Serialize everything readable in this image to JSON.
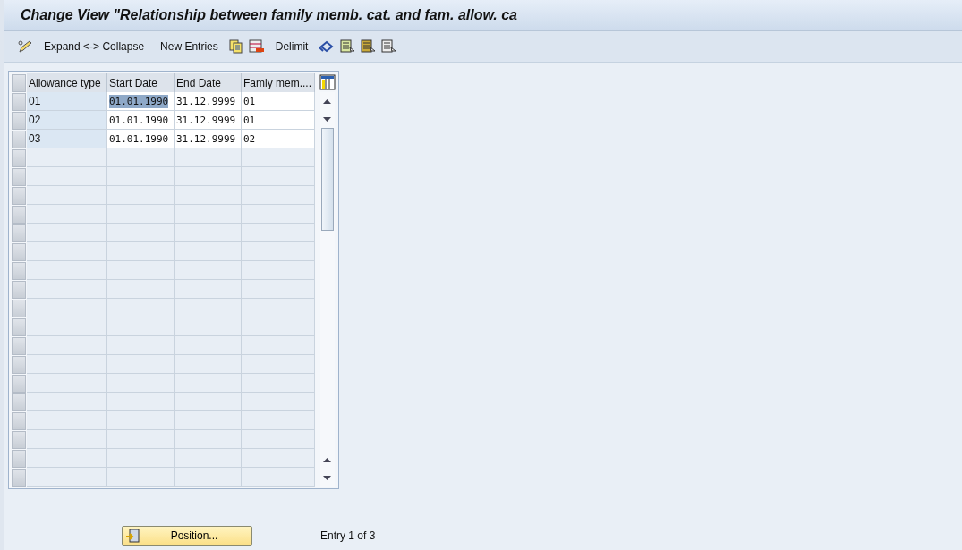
{
  "window": {
    "title": "Change View \"Relationship between family memb. cat. and fam. allow. ca"
  },
  "toolbar": {
    "items": [
      {
        "kind": "icon"
      },
      {
        "kind": "text",
        "label": "Expand <-> Collapse"
      },
      {
        "kind": "text",
        "label": "New Entries"
      },
      {
        "kind": "icon"
      },
      {
        "kind": "icon"
      },
      {
        "kind": "text",
        "label": "Delimit"
      },
      {
        "kind": "icon"
      },
      {
        "kind": "icon"
      },
      {
        "kind": "icon"
      },
      {
        "kind": "icon"
      }
    ]
  },
  "table": {
    "columns": [
      "Allowance type",
      "Start Date",
      "End Date",
      "Famly mem...."
    ],
    "rows": [
      {
        "cells": [
          "01",
          "01.01.1990",
          "31.12.9999",
          "01"
        ],
        "start_date_selected": true
      },
      {
        "cells": [
          "02",
          "01.01.1990",
          "31.12.9999",
          "01"
        ],
        "start_date_selected": false
      },
      {
        "cells": [
          "03",
          "01.01.1990",
          "31.12.9999",
          "02"
        ],
        "start_date_selected": false
      }
    ]
  },
  "footer": {
    "position_button": "Position...",
    "entry_info": "Entry 1 of 3"
  }
}
